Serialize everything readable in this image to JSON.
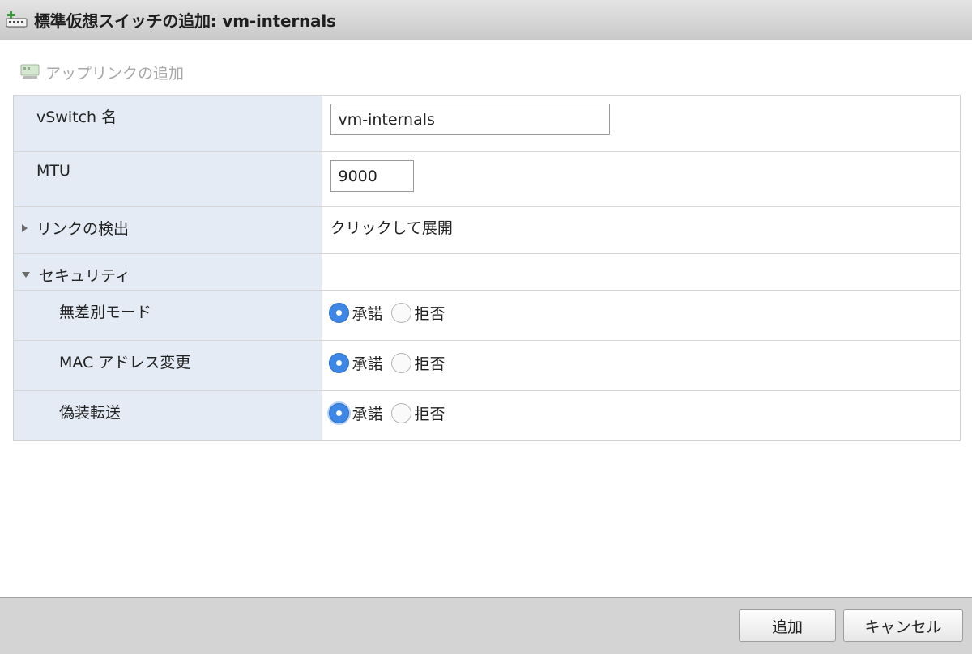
{
  "window": {
    "title": "標準仮想スイッチの追加: vm-internals",
    "icon": "vswitch-add-icon"
  },
  "toolbar": {
    "add_uplink_label": "アップリンクの追加",
    "add_uplink_icon": "uplink-icon"
  },
  "form": {
    "vswitch_name": {
      "label": "vSwitch 名",
      "value": "vm-internals"
    },
    "mtu": {
      "label": "MTU",
      "value": "9000"
    },
    "link_discovery": {
      "label": "リンクの検出",
      "value": "クリックして展開"
    },
    "security": {
      "label": "セキュリティ",
      "promiscuous": {
        "label": "無差別モード",
        "accept_label": "承諾",
        "reject_label": "拒否",
        "selected": "承諾"
      },
      "mac_change": {
        "label": "MAC アドレス変更",
        "accept_label": "承諾",
        "reject_label": "拒否",
        "selected": "承諾"
      },
      "forged_transmits": {
        "label": "偽装転送",
        "accept_label": "承諾",
        "reject_label": "拒否",
        "selected": "承諾"
      }
    }
  },
  "footer": {
    "add_label": "追加",
    "cancel_label": "キャンセル"
  },
  "colors": {
    "label_bg": "#e4ebf4",
    "radio_selected": "#3d87e6",
    "titlebar": "#d6d6d6",
    "footer": "#d4d4d4"
  }
}
